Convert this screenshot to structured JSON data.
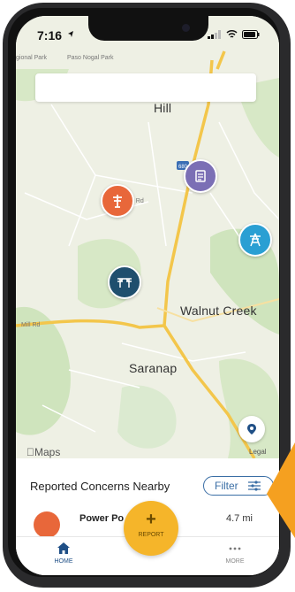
{
  "status_bar": {
    "time": "7:16"
  },
  "map": {
    "labels": {
      "park": "gional Park",
      "road_top": "Paso Nogal Park",
      "hill": "Hill",
      "walnut_creek": "Walnut Creek",
      "saranap": "Saranap",
      "rd_label": "ry Rd",
      "mill_rd": "Mill Rd"
    },
    "maps_logo": "Maps",
    "legal": "Legal",
    "highway": "680",
    "colors": {
      "orange_pin": "#e8673a",
      "purple_pin": "#7b6fb5",
      "navy_pin": "#1f4f6e",
      "teal_pin": "#2a9fd3",
      "road": "#f3c64b"
    }
  },
  "panel": {
    "title": "Reported Concerns Nearby",
    "filter_label": "Filter",
    "concern": {
      "title": "Power Po",
      "distance": "4.7 mi"
    }
  },
  "tabbar": {
    "home_label": "HOME",
    "report_label": "REPORT",
    "more_label": "MORE"
  },
  "icons": [
    "location-arrow-icon",
    "signal-icon",
    "wifi-icon",
    "battery-icon",
    "power-pole-icon",
    "document-icon",
    "transmission-tower-icon",
    "power-lines-icon",
    "location-pin-icon",
    "filter-icon",
    "home-icon",
    "plus-icon",
    "more-dots-icon"
  ]
}
